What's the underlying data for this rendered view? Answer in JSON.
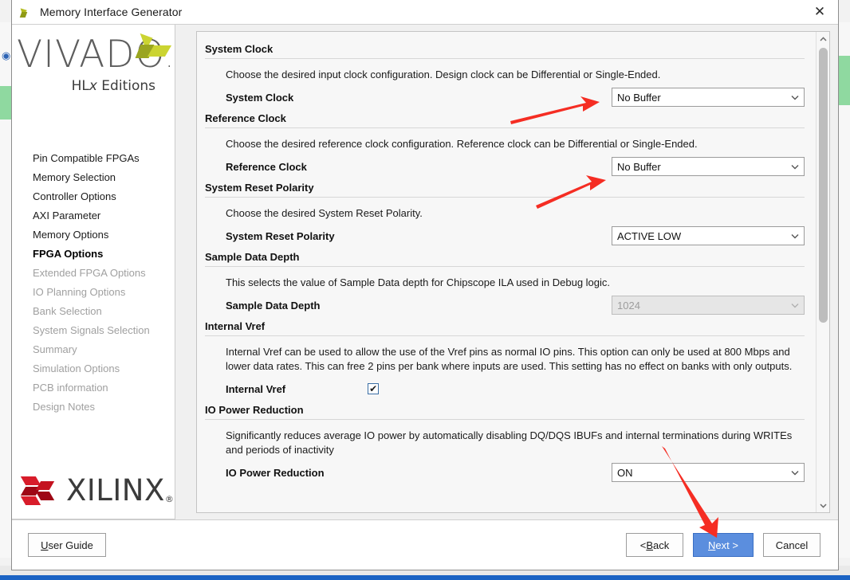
{
  "window": {
    "title": "Memory Interface Generator",
    "icon": "vivado-icon",
    "close_label": "✕"
  },
  "sidebar": {
    "logo": {
      "word": "VIVADO",
      "dot": ".",
      "sub_prefix": "HL",
      "sub_italic": "x",
      "sub_suffix": " Editions"
    },
    "items": [
      {
        "label": "Pin Compatible FPGAs",
        "state": "enabled"
      },
      {
        "label": "Memory Selection",
        "state": "enabled"
      },
      {
        "label": "Controller Options",
        "state": "enabled"
      },
      {
        "label": "AXI Parameter",
        "state": "enabled"
      },
      {
        "label": "Memory Options",
        "state": "enabled"
      },
      {
        "label": "FPGA Options",
        "state": "active"
      },
      {
        "label": "Extended FPGA Options",
        "state": "disabled"
      },
      {
        "label": "IO Planning Options",
        "state": "disabled"
      },
      {
        "label": "Bank Selection",
        "state": "disabled"
      },
      {
        "label": "System Signals Selection",
        "state": "disabled"
      },
      {
        "label": "Summary",
        "state": "disabled"
      },
      {
        "label": "Simulation Options",
        "state": "disabled"
      },
      {
        "label": "PCB information",
        "state": "disabled"
      },
      {
        "label": "Design Notes",
        "state": "disabled"
      }
    ],
    "vendor_logo": {
      "word": "XILINX",
      "registered": "®"
    }
  },
  "main": {
    "sections": [
      {
        "title": "System Clock",
        "description": "Choose the desired input clock configuration. Design clock can be Differential or Single-Ended.",
        "field_label": "System Clock",
        "control": "combo",
        "value": "No Buffer",
        "enabled": true
      },
      {
        "title": "Reference Clock",
        "description": "Choose the desired reference clock configuration. Reference clock can be Differential or Single-Ended.",
        "field_label": "Reference Clock",
        "control": "combo",
        "value": "No Buffer",
        "enabled": true
      },
      {
        "title": "System Reset Polarity",
        "description": "Choose the desired System Reset Polarity.",
        "field_label": "System Reset Polarity",
        "control": "combo",
        "value": "ACTIVE LOW",
        "enabled": true
      },
      {
        "title": "Sample Data Depth",
        "description": "This selects the value of Sample Data depth for Chipscope ILA used in Debug logic.",
        "field_label": "Sample Data Depth",
        "control": "combo",
        "value": "1024",
        "enabled": false
      },
      {
        "title": "Internal Vref",
        "description": "Internal Vref can be used to allow the use of the Vref pins as normal IO pins. This option can only be used at 800 Mbps and lower data rates. This can free 2 pins per bank where inputs are used. This setting has no effect on banks with only outputs.",
        "field_label": "Internal Vref",
        "control": "checkbox",
        "value": "checked",
        "enabled": true
      },
      {
        "title": "IO Power Reduction",
        "description": "Significantly reduces average IO power by automatically disabling DQ/DQS IBUFs and internal terminations during WRITEs and periods of inactivity",
        "field_label": "IO Power Reduction",
        "control": "combo",
        "value": "ON",
        "enabled": true
      }
    ],
    "checkmark": "✔",
    "chevron": "⌄",
    "scrollbar": {
      "up_arrow": "▲",
      "down_arrow": "▼"
    }
  },
  "footer": {
    "user_guide": {
      "pre": "",
      "mnemonic": "U",
      "post": "ser Guide"
    },
    "back": {
      "pre": "< ",
      "mnemonic": "B",
      "post": "ack"
    },
    "next": {
      "pre": "",
      "mnemonic": "N",
      "post": "ext >"
    },
    "cancel": {
      "label": "Cancel"
    }
  },
  "annotations": {
    "color": "#f52d23",
    "arrows": [
      {
        "name": "arrow-to-system-clock-combo"
      },
      {
        "name": "arrow-to-reference-clock-combo"
      },
      {
        "name": "arrow-to-next-button"
      }
    ]
  }
}
